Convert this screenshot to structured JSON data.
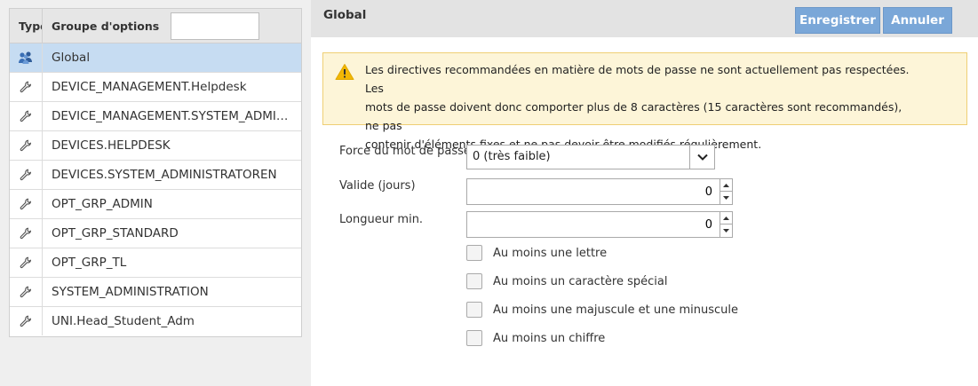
{
  "left_panel": {
    "columns": {
      "type": "Type",
      "name": "Groupe d'options"
    },
    "filter_value": "",
    "rows": [
      {
        "label": "Global",
        "icon": "users-group-icon",
        "selected": true
      },
      {
        "label": "DEVICE_MANAGEMENT.Helpdesk",
        "icon": "wrench-icon"
      },
      {
        "label": "DEVICE_MANAGEMENT.SYSTEM_ADMI…",
        "icon": "wrench-icon"
      },
      {
        "label": "DEVICES.HELPDESK",
        "icon": "wrench-icon"
      },
      {
        "label": "DEVICES.SYSTEM_ADMINISTRATOREN",
        "icon": "wrench-icon"
      },
      {
        "label": "OPT_GRP_ADMIN",
        "icon": "wrench-icon"
      },
      {
        "label": "OPT_GRP_STANDARD",
        "icon": "wrench-icon"
      },
      {
        "label": "OPT_GRP_TL",
        "icon": "wrench-icon"
      },
      {
        "label": "SYSTEM_ADMINISTRATION",
        "icon": "wrench-icon"
      },
      {
        "label": "UNI.Head_Student_Adm",
        "icon": "wrench-icon"
      }
    ]
  },
  "right_panel": {
    "title": "Global",
    "buttons": {
      "save": "Enregistrer",
      "cancel": "Annuler"
    },
    "warning": {
      "icon": "warning-triangle-icon",
      "lines": [
        "Les directives recommandées en matière de mots de passe ne sont actuellement pas respectées. Les",
        "mots de passe doivent donc comporter plus de 8 caractères (15 caractères sont recommandés), ne pas",
        "contenir d'éléments fixes et ne pas devoir être modifiés régulièrement."
      ]
    },
    "form": {
      "strength_label": "Force du mot de passe",
      "strength_value": "0 (très faible)",
      "valid_label": "Valide (jours)",
      "valid_value": "0",
      "minlen_label": "Longueur min.",
      "minlen_value": "0",
      "checkboxes": [
        {
          "label": "Au moins une lettre",
          "checked": false
        },
        {
          "label": "Au moins un caractère spécial",
          "checked": false
        },
        {
          "label": "Au moins une majuscule et une minuscule",
          "checked": false
        },
        {
          "label": "Au moins un chiffre",
          "checked": false
        }
      ]
    }
  },
  "colors": {
    "button_bg": "#7aa7d8",
    "selected_row": "#c6dcf2",
    "warning_bg": "#fdf5d8",
    "warning_border": "#efcf75",
    "warning_icon": "#f2b705"
  }
}
